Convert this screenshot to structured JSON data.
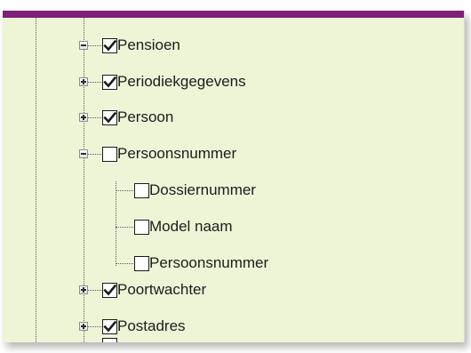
{
  "tree": {
    "items": [
      {
        "label": "Pensioen",
        "checked": true,
        "expander": "collapsed"
      },
      {
        "label": "Periodiekgegevens",
        "checked": true,
        "expander": "collapsed"
      },
      {
        "label": "Persoon",
        "checked": true,
        "expander": "collapsed"
      },
      {
        "label": "Persoonsnummer",
        "checked": false,
        "expander": "expanded",
        "children": [
          {
            "label": "Dossiernummer",
            "checked": false
          },
          {
            "label": "Model naam",
            "checked": false
          },
          {
            "label": "Persoonsnummer",
            "checked": false
          }
        ]
      },
      {
        "label": "Poortwachter",
        "checked": true,
        "expander": "collapsed"
      },
      {
        "label": "Postadres",
        "checked": true,
        "expander": "collapsed"
      }
    ]
  },
  "colors": {
    "panel_bg": "#eef5d6",
    "top_bar": "#7f1f78",
    "tree_line": "#5a5a5a",
    "check_mark": "#1a1a1a"
  },
  "icons": {
    "expander_collapsed": "plus-box-icon",
    "expander_expanded": "minus-box-icon",
    "check": "checkmark-icon"
  }
}
